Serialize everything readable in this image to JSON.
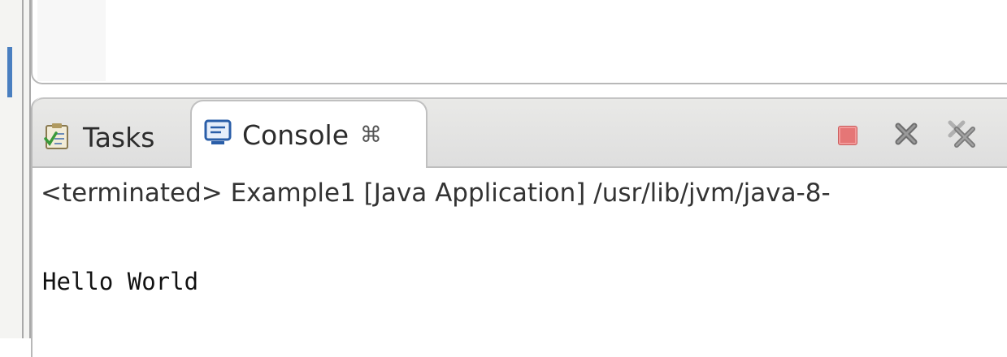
{
  "views": {
    "tabs": [
      {
        "label": "Tasks",
        "icon": "tasks-clipboard-icon",
        "active": false
      },
      {
        "label": "Console",
        "icon": "console-monitor-icon",
        "active": true,
        "close_glyph": "⌘"
      }
    ],
    "toolbar": [
      {
        "name": "terminate",
        "icon": "terminate-square-icon",
        "color": "#e57676"
      },
      {
        "name": "remove-launch",
        "icon": "remove-x-icon"
      },
      {
        "name": "remove-all-terminated",
        "icon": "remove-all-x-icon"
      }
    ]
  },
  "console": {
    "header": "<terminated> Example1 [Java Application] /usr/lib/jvm/java-8-",
    "output_lines": [
      "Hello World"
    ]
  },
  "colors": {
    "accent_marker": "#4a7fc0",
    "terminate": "#e57676"
  }
}
